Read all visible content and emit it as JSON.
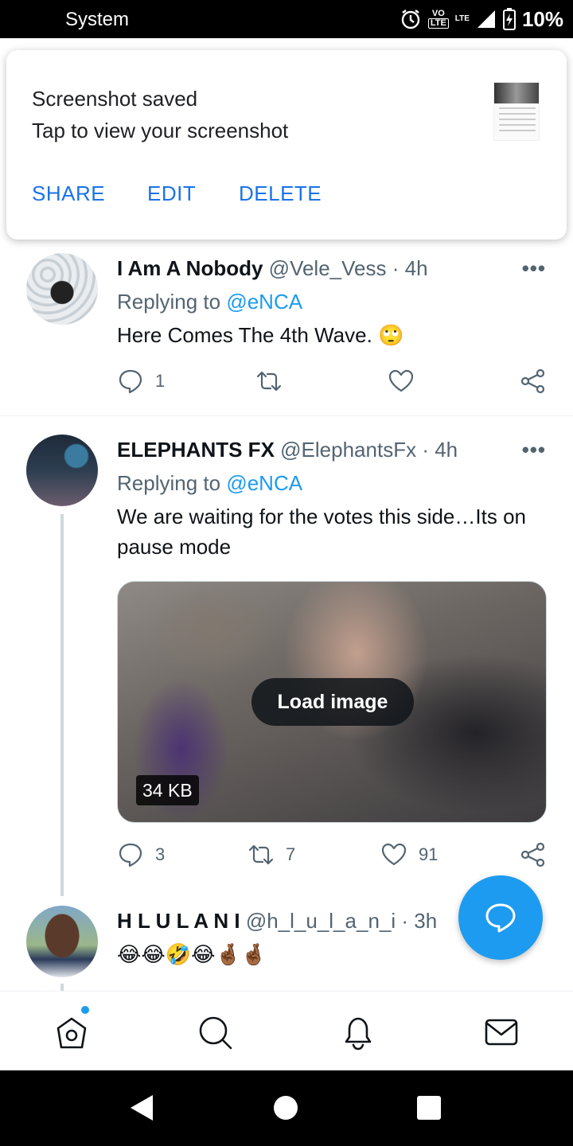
{
  "status_bar": {
    "label": "System",
    "network": "LTE",
    "volte_top": "VO",
    "volte_bottom": "LTE",
    "battery": "10%"
  },
  "notification": {
    "title": "Screenshot saved",
    "subtitle": "Tap to view your screenshot",
    "actions": [
      "SHARE",
      "EDIT",
      "DELETE"
    ]
  },
  "tweets": [
    {
      "name": "I Am A Nobody",
      "handle": "@Vele_Vess",
      "time": "· 4h",
      "replying_prefix": "Replying to ",
      "replying_to": "@eNCA",
      "text": "Here Comes The 4th Wave. 🙄",
      "reply_count": "1",
      "retweet_count": "",
      "like_count": ""
    },
    {
      "name": "ELEPHANTS FX",
      "handle": "@ElephantsFx",
      "time": "· 4h",
      "replying_prefix": "Replying to ",
      "replying_to": "@eNCA",
      "text": "We are waiting for the votes this side…Its on pause mode",
      "media_button": "Load image",
      "media_size": "34 KB",
      "reply_count": "3",
      "retweet_count": "7",
      "like_count": "91"
    },
    {
      "name": "H L U L A N I",
      "handle": "@h_l_u_l_a_n_i",
      "time": "· 3h",
      "text": "😂😂🤣😂🤞🏾🤞🏾"
    }
  ],
  "more_label": "•••",
  "colors": {
    "accent": "#1d9bf0",
    "notification_action": "#1a73e8"
  },
  "icons": [
    "alarm-icon",
    "signal-icon",
    "battery-icon",
    "reply-icon",
    "retweet-icon",
    "like-icon",
    "share-icon",
    "compose-icon",
    "home-icon",
    "search-icon",
    "notifications-icon",
    "messages-icon",
    "back-icon",
    "home-circle-icon",
    "recents-icon"
  ]
}
